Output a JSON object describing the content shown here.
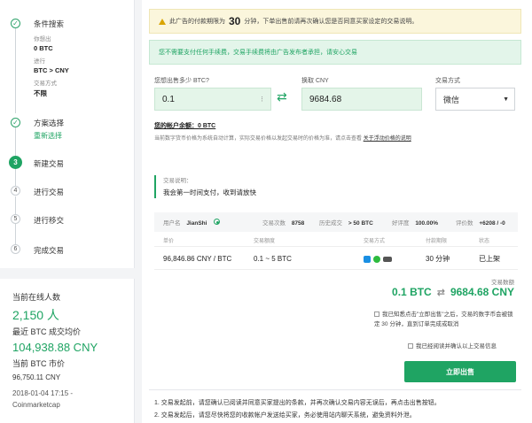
{
  "sidebar": {
    "steps": [
      {
        "num": "✓",
        "title": "条件搜索",
        "details": [
          {
            "label": "你想出",
            "value": "0 BTC"
          },
          {
            "label": "进行",
            "value": "BTC > CNY"
          },
          {
            "label": "交易方式",
            "value": "不限"
          }
        ]
      },
      {
        "num": "✓",
        "title": "方案选择",
        "link": "重新选择"
      },
      {
        "num": "3",
        "title": "新建交易"
      },
      {
        "num": "4",
        "title": "进行交易"
      },
      {
        "num": "5",
        "title": "进行移交"
      },
      {
        "num": "6",
        "title": "完成交易"
      }
    ],
    "stats": {
      "online_label": "当前在线人数",
      "online_value": "2,150 人",
      "latest_price_label": "最近 BTC 成交均价",
      "latest_price_value": "104,938.88 CNY",
      "market_price_label": "当前 BTC 市价",
      "market_price_value": "96,750.11 CNY",
      "timestamp": "2018-01-04 17:15 -",
      "source": "Coinmarketcap"
    }
  },
  "main": {
    "warning": {
      "prefix": "此广告的付款期限为",
      "minutes": "30",
      "suffix": "分钟，下单出售前请再次确认您是否同意买家设定的交易说明。"
    },
    "fee_notice": "您不需要支付任何手续费，交易手续费将由广告发布者承担，请安心交易",
    "btc_label": "您想出售多少 BTC?",
    "btc_value": "0.1",
    "cny_label": "换取 CNY",
    "cny_value": "9684.68",
    "method_label": "交易方式",
    "method_value": "微信",
    "balance": "您的帐户余额：0 BTC",
    "rate_note": "当前数字货币价格为系统自动计算，实际交易价格以发起交易时的价格为准，请点击查看",
    "rate_link": "关于浮动价格的说明",
    "trade_note_label": "交易说明：",
    "trade_note_text": "我会第一时间支付，收到请放快",
    "user": {
      "name_label": "用户名",
      "name": "JianShi",
      "trades_label": "交易次数",
      "trades": "8758",
      "history_label": "历史成交",
      "history": "> 50 BTC",
      "rating_label": "好评度",
      "rating": "100.00%",
      "score_label": "评价数",
      "score": "+6208 / -0"
    },
    "table": {
      "headers": [
        "单价",
        "交易额度",
        "交易方式",
        "付款期限",
        "状态"
      ],
      "row": {
        "price": "96,846.86 CNY / BTC",
        "limit": "0.1 ~ 5 BTC",
        "term": "30 分钟",
        "status": "已上架"
      }
    },
    "total_label": "交易数额",
    "total_btc": "0.1 BTC",
    "total_cny": "9684.68 CNY",
    "confirm_text": "我已知悉点击\"立即出售\"之后，交易的数字币会被锁定 30 分钟，直到订单完成或取消",
    "confirm_read": "我已经阅读并确认以上交易信息",
    "sell_button": "立即出售",
    "notes": [
      "1. 交易发起前，请您确认已阅读并同意买家提出的条款，并再次确认交易内容无误后，再点击出售按钮。",
      "2. 交易发起后，请您尽快将您的收款帐户发送给买家，务必使用站内聊天系统，避免资料外泄。"
    ]
  }
}
